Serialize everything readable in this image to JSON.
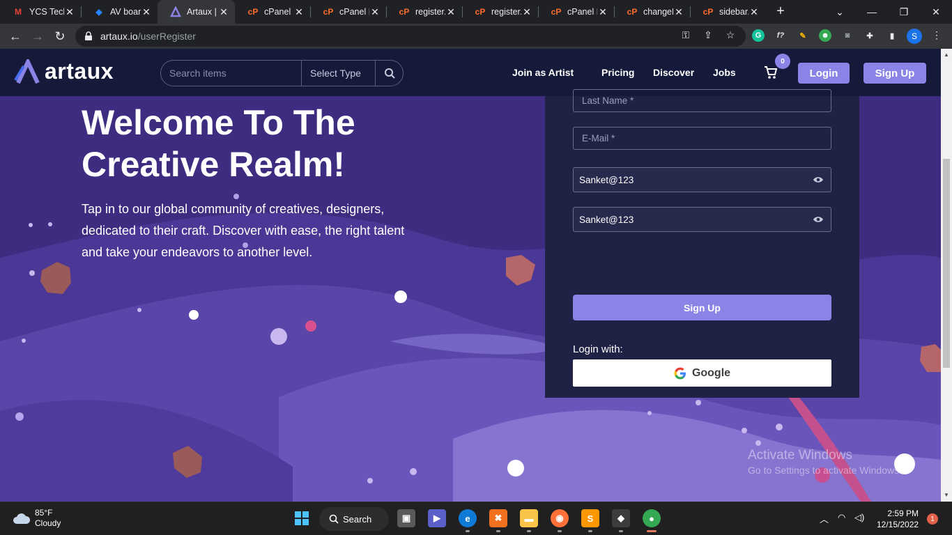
{
  "browser": {
    "tabs": [
      {
        "title": "YCS Tech",
        "icon": "gmail-icon",
        "color": "#ea4335"
      },
      {
        "title": "AV board",
        "icon": "jira-icon",
        "color": "#2684ff"
      },
      {
        "title": "Artaux |",
        "icon": "artaux-icon",
        "color": "#8a84e6",
        "active": true
      },
      {
        "title": "cPanel -",
        "icon": "cpanel-icon",
        "color": "#ff6c2c"
      },
      {
        "title": "cPanel F",
        "icon": "cpanel-icon",
        "color": "#ff6c2c"
      },
      {
        "title": "register.",
        "icon": "cpanel-icon",
        "color": "#ff6c2c"
      },
      {
        "title": "register.",
        "icon": "cpanel-icon",
        "color": "#ff6c2c"
      },
      {
        "title": "cPanel F",
        "icon": "cpanel-icon",
        "color": "#ff6c2c"
      },
      {
        "title": "changeF",
        "icon": "cpanel-icon",
        "color": "#ff6c2c"
      },
      {
        "title": "sidebar.",
        "icon": "cpanel-icon",
        "color": "#ff6c2c"
      }
    ],
    "url_domain": "artaux.io",
    "url_path": "/userRegister",
    "profile_initial": "S"
  },
  "site": {
    "logo_text": "artaux",
    "search_placeholder": "Search items",
    "select_type": "Select Type",
    "nav": {
      "join_artist": "Join as Artist",
      "pricing": "Pricing",
      "discover": "Discover",
      "jobs": "Jobs"
    },
    "cart_count": "0",
    "login": "Login",
    "signup": "Sign Up"
  },
  "hero": {
    "title": "Welcome To The Creative Realm!",
    "subtitle": "Tap in to our global community of creatives, designers, dedicated to their craft. Discover with ease, the right talent and take your endeavors to another level."
  },
  "form": {
    "last_name_placeholder": "Last Name *",
    "email_placeholder": "E-Mail *",
    "password_value": "Sanket@123",
    "confirm_password_value": "Sanket@123",
    "submit": "Sign Up",
    "login_with": "Login with:",
    "google": "Google"
  },
  "watermark": {
    "line1": "Activate Windows",
    "line2": "Go to Settings to activate Windows."
  },
  "taskbar": {
    "weather_temp": "85°F",
    "weather_desc": "Cloudy",
    "search": "Search",
    "time": "2:59 PM",
    "date": "12/15/2022",
    "notifications": "1"
  },
  "colors": {
    "accent": "#8a84e6",
    "header_bg": "#161a3a",
    "panel_bg": "#1f2244",
    "page_bg": "#3a2a78"
  }
}
